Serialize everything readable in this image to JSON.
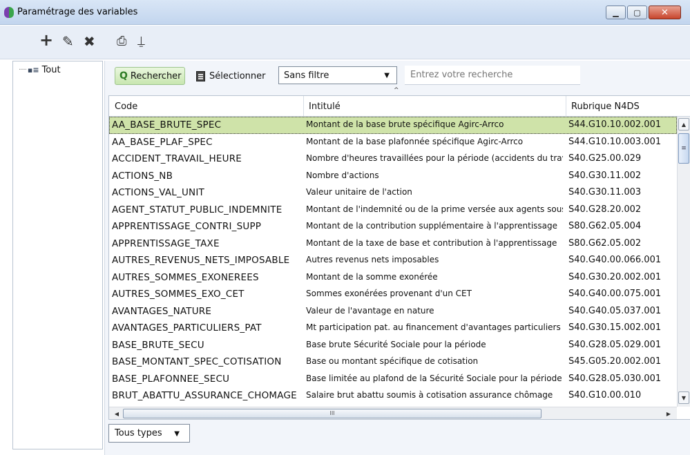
{
  "window": {
    "title": "Paramétrage des variables",
    "min_symbol": "▁",
    "max_symbol": "▢",
    "close_symbol": "✕"
  },
  "toolbar": {
    "add_symbol": "+",
    "edit_symbol": "✎",
    "delete_symbol": "✖",
    "print_symbol": "⎙",
    "export_symbol": "⍊"
  },
  "sidebar": {
    "tree_line": "·····",
    "tree_icon": "▪≡",
    "root_label": "Tout"
  },
  "search": {
    "search_button_label": "Rechercher",
    "search_icon": "Q",
    "select_button_label": "Sélectionner",
    "filter_value": "Sans filtre",
    "placeholder": "Entrez votre recherche",
    "collapse_caret": "^"
  },
  "grid": {
    "columns": [
      "Code",
      "Intitulé",
      "Rubrique N4DS"
    ],
    "rows": [
      {
        "code": "AA_BASE_BRUTE_SPEC",
        "intitule": "Montant de la base brute spécifique Agirc-Arrco",
        "rubrique": "S44.G10.10.002.001"
      },
      {
        "code": "AA_BASE_PLAF_SPEC",
        "intitule": "Montant de la base plafonnée spécifique Agirc-Arrco",
        "rubrique": "S44.G10.10.003.001"
      },
      {
        "code": "ACCIDENT_TRAVAIL_HEURE",
        "intitule": "Nombre d'heures travaillées pour la période (accidents du trav...",
        "rubrique": "S40.G25.00.029"
      },
      {
        "code": "ACTIONS_NB",
        "intitule": "Nombre d'actions",
        "rubrique": "S40.G30.11.002"
      },
      {
        "code": "ACTIONS_VAL_UNIT",
        "intitule": "Valeur unitaire de l'action",
        "rubrique": "S40.G30.11.003"
      },
      {
        "code": "AGENT_STATUT_PUBLIC_INDEMNITE",
        "intitule": "Montant de l'indemnité ou de la prime versée aux agents sous ...",
        "rubrique": "S40.G28.20.002"
      },
      {
        "code": "APPRENTISSAGE_CONTRI_SUPP",
        "intitule": "Montant de la contribution supplémentaire à  l'apprentissage",
        "rubrique": "S80.G62.05.004"
      },
      {
        "code": "APPRENTISSAGE_TAXE",
        "intitule": "Montant de la taxe de base et contribution à  l'apprentissage",
        "rubrique": "S80.G62.05.002"
      },
      {
        "code": "AUTRES_REVENUS_NETS_IMPOSABLE",
        "intitule": "Autres revenus nets imposables",
        "rubrique": "S40.G40.00.066.001"
      },
      {
        "code": "AUTRES_SOMMES_EXONEREES",
        "intitule": "Montant de la somme exonérée",
        "rubrique": "S40.G30.20.002.001"
      },
      {
        "code": "AUTRES_SOMMES_EXO_CET",
        "intitule": "Sommes exonérées provenant d'un CET",
        "rubrique": "S40.G40.00.075.001"
      },
      {
        "code": "AVANTAGES_NATURE",
        "intitule": "Valeur de l'avantage en nature",
        "rubrique": "S40.G40.05.037.001"
      },
      {
        "code": "AVANTAGES_PARTICULIERS_PAT",
        "intitule": "Mt participation pat. au financement d'avantages particuliers",
        "rubrique": "S40.G30.15.002.001"
      },
      {
        "code": "BASE_BRUTE_SECU",
        "intitule": "Base brute Sécurité Sociale pour la période",
        "rubrique": "S40.G28.05.029.001"
      },
      {
        "code": "BASE_MONTANT_SPEC_COTISATION",
        "intitule": "Base ou montant spécifique de cotisation",
        "rubrique": "S45.G05.20.002.001"
      },
      {
        "code": "BASE_PLAFONNEE_SECU",
        "intitule": "Base limitée au plafond de la Sécurité Sociale pour la période",
        "rubrique": "S40.G28.05.030.001"
      },
      {
        "code": "BRUT_ABATTU_ASSURANCE_CHOMAGE",
        "intitule": "Salaire brut abattu soumis à cotisation assurance chômage",
        "rubrique": "S40.G10.00.010"
      }
    ],
    "vscroll_up": "▲",
    "vscroll_down": "▼",
    "vscroll_grip": "≡",
    "hscroll_left": "◀",
    "hscroll_right": "▶",
    "hscroll_grip": "III"
  },
  "footer": {
    "type_filter_value": "Tous types",
    "dropdown_arrow": "▼"
  },
  "colors": {
    "selected_row": "#cfe3a9",
    "search_button": "#c8e6b0",
    "titlebar": "#c2d5ee",
    "close_button": "#c8452c"
  }
}
